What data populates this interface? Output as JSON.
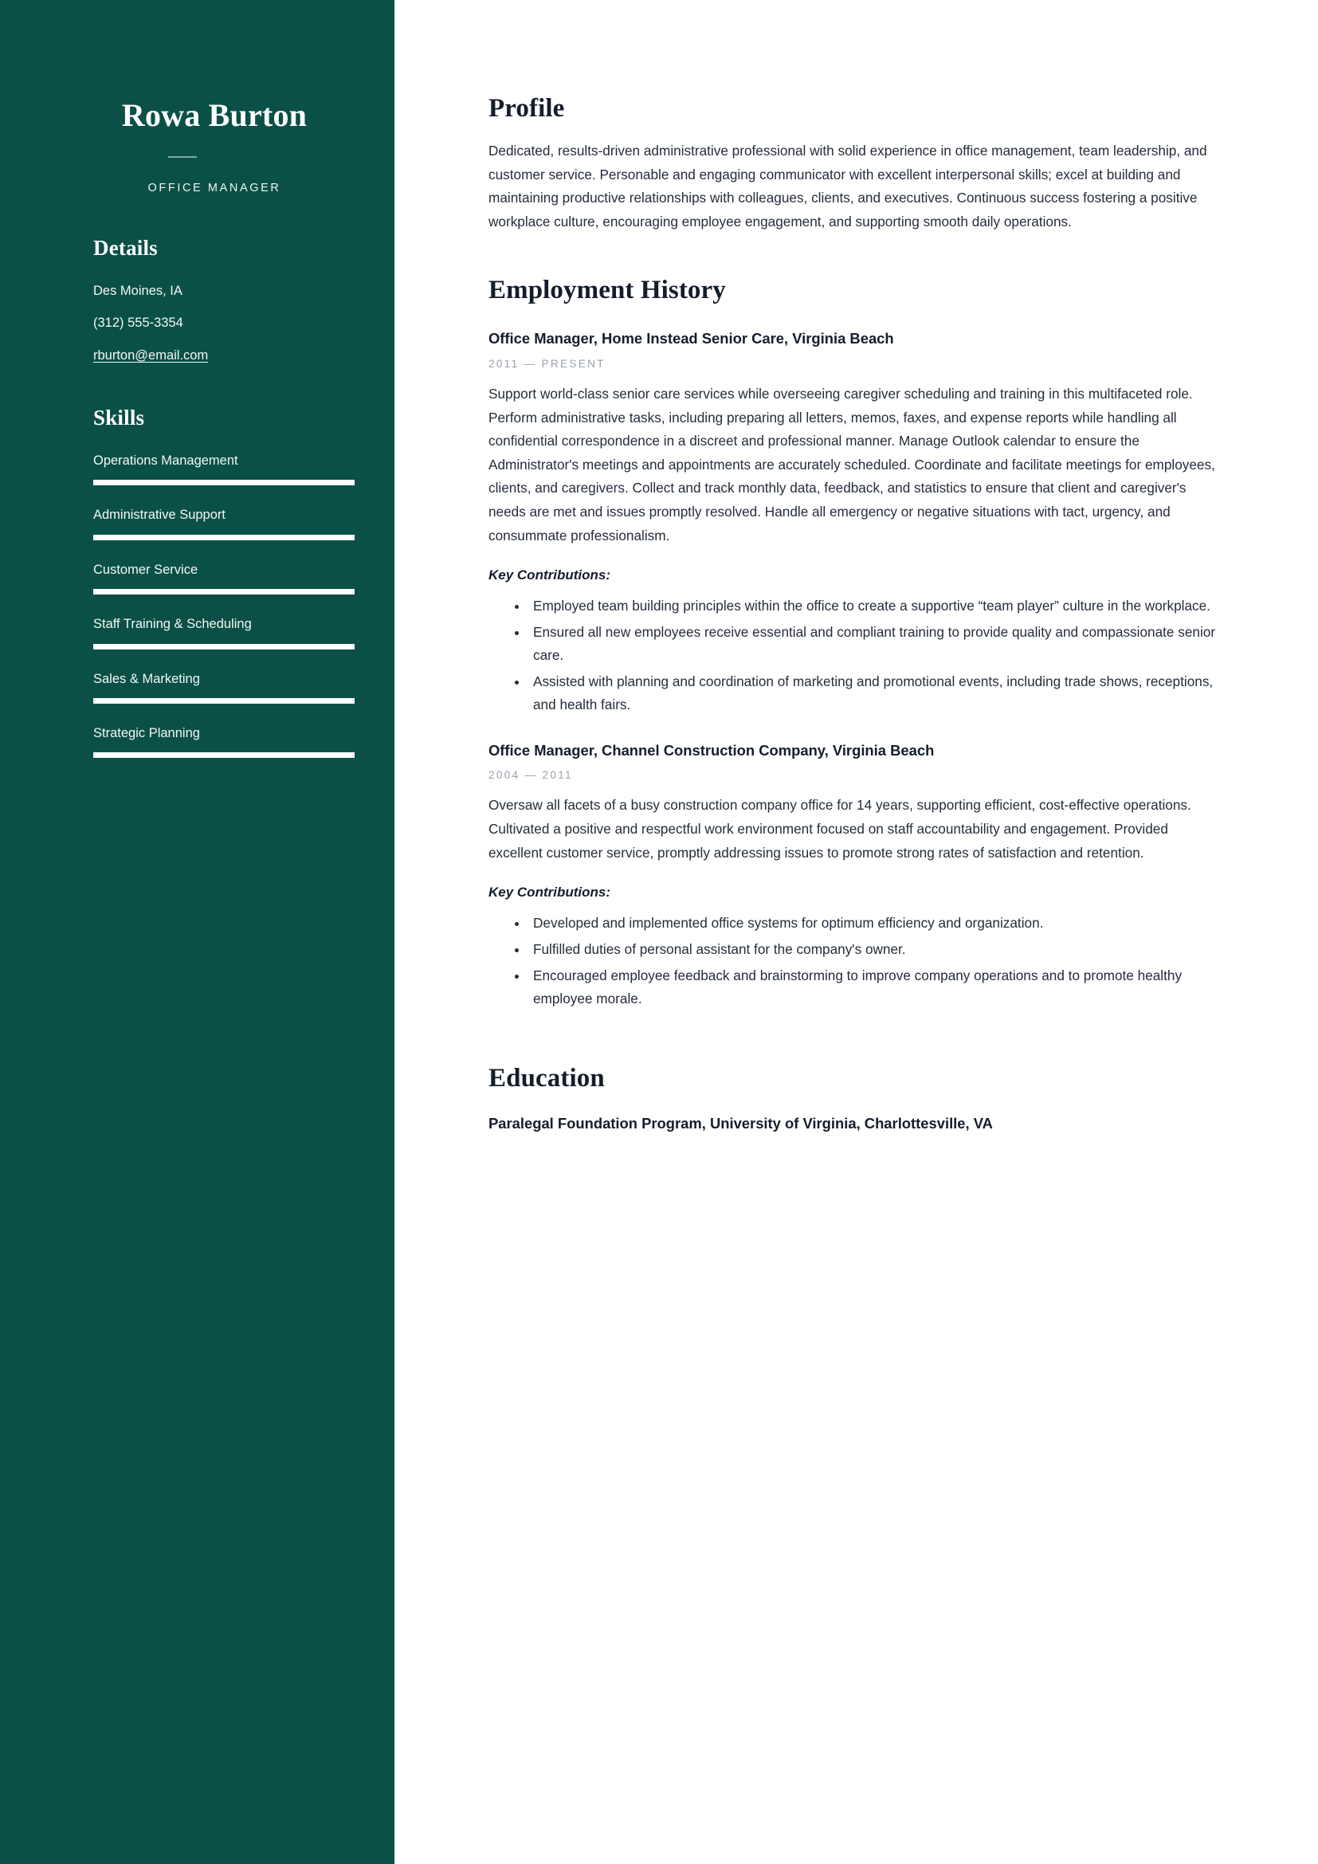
{
  "sidebar": {
    "name": "Rowa Burton",
    "job_title": "OFFICE MANAGER",
    "details_heading": "Details",
    "details": [
      "Des Moines, IA",
      "(312) 555-3354",
      "rburton@email.com"
    ],
    "skills_heading": "Skills",
    "skills": [
      {
        "label": "Operations Management",
        "level": 100
      },
      {
        "label": "Administrative Support",
        "level": 100
      },
      {
        "label": "Customer Service",
        "level": 100
      },
      {
        "label": "Staff Training & Scheduling",
        "level": 100
      },
      {
        "label": "Sales & Marketing",
        "level": 100
      },
      {
        "label": "Strategic Planning",
        "level": 100
      }
    ]
  },
  "main": {
    "profile": {
      "heading": "Profile",
      "text": "Dedicated, results-driven administrative professional with solid experience in office management, team leadership, and customer service. Personable and engaging communicator with excellent interpersonal skills; excel at building and maintaining productive relationships with colleagues, clients, and executives. Continuous success fostering a positive workplace culture, encouraging employee engagement, and supporting smooth daily operations."
    },
    "employment": {
      "heading": "Employment History",
      "jobs": [
        {
          "title": "Office Manager, Home Instead Senior Care, Virginia Beach",
          "dates": "2011 — PRESENT",
          "description": "Support world-class senior care services while overseeing caregiver scheduling and training in this multifaceted role. Perform administrative tasks, including preparing all letters, memos, faxes, and expense reports while handling all confidential correspondence in a discreet and professional manner. Manage Outlook calendar to ensure the Administrator's meetings and appointments are accurately scheduled. Coordinate and facilitate meetings for employees, clients, and caregivers. Collect and track monthly data, feedback, and statistics to ensure that client and caregiver's needs are met and issues promptly resolved. Handle all emergency or negative situations with tact, urgency, and consummate professionalism.",
          "contributions_label": "Key Contributions:",
          "contributions": [
            "Employed team building principles within the office to create a supportive “team player” culture in the workplace.",
            "Ensured all new employees receive essential and compliant training to provide quality and compassionate senior care.",
            "Assisted with planning and coordination of marketing and promotional events, including trade shows, receptions, and health fairs."
          ]
        },
        {
          "title": "Office Manager, Channel Construction Company,  Virginia Beach",
          "dates": "2004 — 2011",
          "description": "Oversaw all facets of a busy construction company office for 14 years, supporting efficient, cost-effective operations. Cultivated a positive and respectful work environment focused on staff accountability and engagement. Provided excellent customer service, promptly addressing issues to promote strong rates of satisfaction and retention.",
          "contributions_label": "Key Contributions:",
          "contributions": [
            "Developed and implemented office systems for optimum efficiency and organization.",
            "Fulfilled duties of personal assistant for the company's owner.",
            "Encouraged employee feedback and brainstorming to improve company operations and to promote healthy employee morale."
          ]
        }
      ]
    },
    "education": {
      "heading": "Education",
      "entries": [
        "Paralegal Foundation Program, University of Virginia, Charlottesville, VA"
      ]
    }
  },
  "colors": {
    "sidebar_bg": "#0a5046",
    "sidebar_text": "#ffffff",
    "heading": "#151d2b",
    "body_text": "#252d3b",
    "muted": "#9aa1ac"
  }
}
